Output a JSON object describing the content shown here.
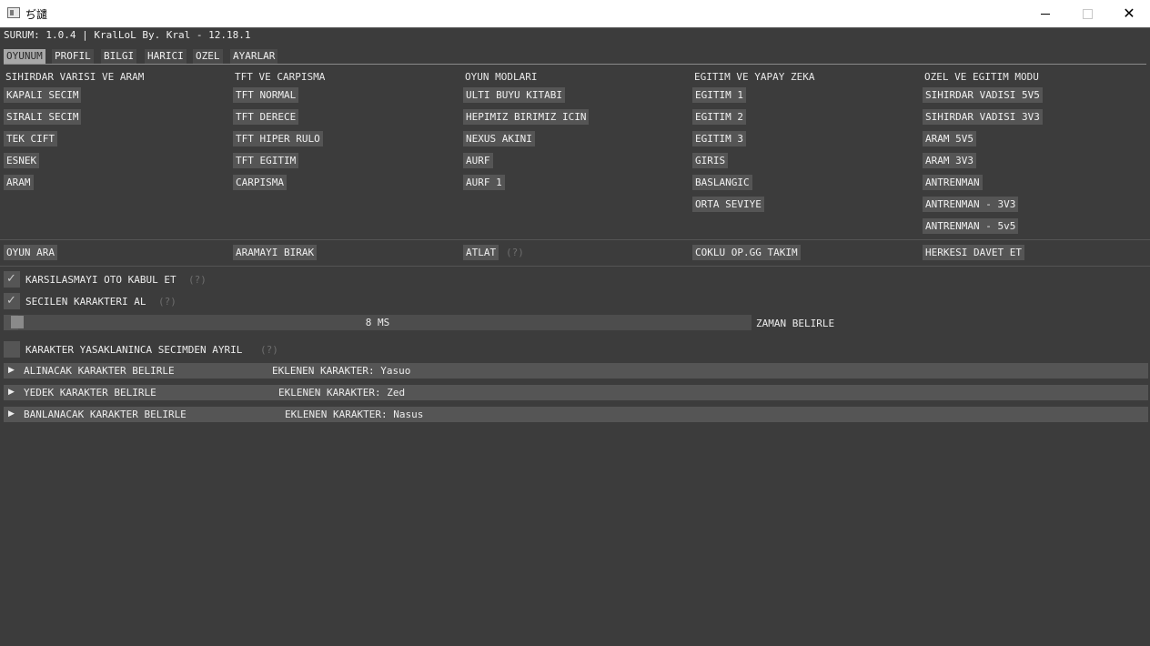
{
  "window": {
    "title": "ぢ譴"
  },
  "version_line": "SURUM: 1.0.4 | KralLoL By. Kral - 12.18.1",
  "tabs": [
    {
      "label": "OYUNUM",
      "active": true
    },
    {
      "label": "PROFIL",
      "active": false
    },
    {
      "label": "BILGI",
      "active": false
    },
    {
      "label": "HARICI",
      "active": false
    },
    {
      "label": "OZEL",
      "active": false
    },
    {
      "label": "AYARLAR",
      "active": false
    }
  ],
  "columns": [
    {
      "heading": "SIHIRDAR VARISI VE ARAM",
      "buttons": [
        "KAPALI SECIM",
        "SIRALI SECIM",
        "TEK CIFT",
        "ESNEK",
        "ARAM"
      ]
    },
    {
      "heading": "TFT VE CARPISMA",
      "buttons": [
        "TFT NORMAL",
        "TFT DERECE",
        "TFT HIPER RULO",
        "TFT EGITIM",
        "CARPISMA"
      ]
    },
    {
      "heading": "OYUN MODLARI",
      "buttons": [
        "ULTI BUYU KITABI",
        "HEPIMIZ BIRIMIZ ICIN",
        "NEXUS AKINI",
        "AURF",
        "AURF 1"
      ]
    },
    {
      "heading": "EGITIM VE YAPAY ZEKA",
      "buttons": [
        "EGITIM 1",
        "EGITIM 2",
        "EGITIM 3",
        "GIRIS",
        "BASLANGIC",
        "ORTA SEVIYE"
      ]
    },
    {
      "heading": "OZEL VE EGITIM MODU",
      "buttons": [
        "SIHIRDAR VADISI 5V5",
        "SIHIRDAR VADISI 3V3",
        "ARAM 5V5",
        "ARAM 3V3",
        "ANTRENMAN",
        "ANTRENMAN - 3V3",
        "ANTRENMAN - 5v5"
      ]
    }
  ],
  "actions": {
    "find_game": "OYUN ARA",
    "stop_search": "ARAMAYI BIRAK",
    "skip": "ATLAT",
    "skip_help": "(?)",
    "multi_opgg": "COKLU OP.GG TAKIM",
    "invite_all": "HERKESI DAVET ET"
  },
  "options": {
    "auto_accept": {
      "label": "KARSILASMAYI OTO KABUL ET",
      "help": "(?)",
      "checked": true
    },
    "take_champion": {
      "label": "SECILEN KARAKTERI AL",
      "help": "(?)",
      "checked": true
    },
    "delay": {
      "value_text": "8 MS",
      "level": 0.02,
      "label": "ZAMAN BELIRLE"
    },
    "dodge_on_ban": {
      "label": "KARAKTER YASAKLANINCA SECIMDEN AYRIL",
      "help": "(?)",
      "checked": false
    }
  },
  "sections": [
    {
      "title": "ALINACAK KARAKTER BELIRLE",
      "info": "EKLENEN KARAKTER: Yasuo"
    },
    {
      "title": "YEDEK KARAKTER BELIRLE",
      "info": "EKLENEN KARAKTER: Zed"
    },
    {
      "title": "BANLANACAK KARAKTER BELIRLE",
      "info": "EKLENEN KARAKTER: Nasus"
    }
  ],
  "icons": {
    "expand": "triangle-right-icon",
    "check": "checkmark-icon",
    "minimize": "minimize-icon",
    "maximize": "maximize-icon",
    "close": "close-icon"
  }
}
